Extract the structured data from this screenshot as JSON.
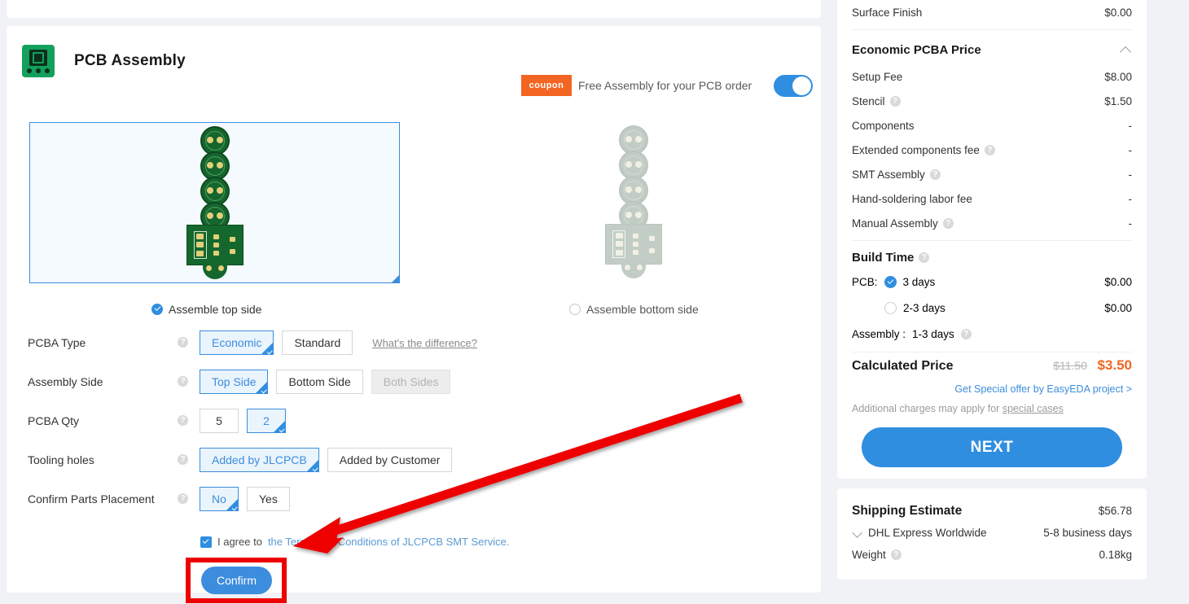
{
  "main": {
    "title": "PCB Assembly",
    "coupon": {
      "badge": "coupon",
      "text": "Free Assembly for your PCB order"
    },
    "sides": {
      "top": "Assemble top side",
      "bottom": "Assemble bottom side"
    },
    "rows": [
      {
        "label": "PCBA Type",
        "options": [
          {
            "label": "Economic",
            "state": "selected"
          },
          {
            "label": "Standard",
            "state": "normal"
          }
        ],
        "link": "What's the difference?"
      },
      {
        "label": "Assembly Side",
        "options": [
          {
            "label": "Top Side",
            "state": "selected"
          },
          {
            "label": "Bottom Side",
            "state": "normal"
          },
          {
            "label": "Both Sides",
            "state": "disabled"
          }
        ]
      },
      {
        "label": "PCBA Qty",
        "options": [
          {
            "label": "5",
            "state": "normal"
          },
          {
            "label": "2",
            "state": "selected"
          }
        ]
      },
      {
        "label": "Tooling holes",
        "options": [
          {
            "label": "Added by JLCPCB",
            "state": "selected"
          },
          {
            "label": "Added by Customer",
            "state": "normal"
          }
        ]
      },
      {
        "label": "Confirm Parts Placement",
        "options": [
          {
            "label": "No",
            "state": "selected"
          },
          {
            "label": "Yes",
            "state": "normal"
          }
        ]
      }
    ],
    "agree": {
      "prefix": "I agree to",
      "link": "the Terms and Conditions of JLCPCB SMT Service."
    },
    "confirm_label": "Confirm"
  },
  "summary": {
    "surface_finish": {
      "label": "Surface Finish",
      "value": "$0.00"
    },
    "price_section_title": "Economic PCBA Price",
    "price_rows": [
      {
        "label": "Setup Fee",
        "value": "$8.00",
        "help": false
      },
      {
        "label": "Stencil",
        "value": "$1.50",
        "help": true
      },
      {
        "label": "Components",
        "value": "-",
        "help": false
      },
      {
        "label": "Extended components fee",
        "value": "-",
        "help": true
      },
      {
        "label": "SMT Assembly",
        "value": "-",
        "help": true
      },
      {
        "label": "Hand-soldering labor fee",
        "value": "-",
        "help": false
      },
      {
        "label": "Manual Assembly",
        "value": "-",
        "help": true
      }
    ],
    "build_time": {
      "title": "Build Time",
      "pcb_label": "PCB:",
      "options": [
        {
          "label": "3 days",
          "value": "$0.00",
          "selected": true
        },
        {
          "label": "2-3 days",
          "value": "$0.00",
          "selected": false
        }
      ],
      "assembly_label": "Assembly :",
      "assembly_value": "1-3 days"
    },
    "calculated": {
      "title": "Calculated Price",
      "old_price": "$11.50",
      "new_price": "$3.50",
      "offer_link": "Get Special offer by EasyEDA project >",
      "note_prefix": "Additional charges may apply for ",
      "note_link": "special cases"
    },
    "next_label": "NEXT"
  },
  "shipping": {
    "title": "Shipping Estimate",
    "price": "$56.78",
    "carrier": "DHL Express Worldwide",
    "eta": "5-8 business days",
    "weight_label": "Weight",
    "weight_value": "0.18kg"
  },
  "colors": {
    "accent_blue": "#2f8ee0",
    "border_blue": "#3c8dde",
    "orange": "#f26522",
    "highlight_red": "#ee0000",
    "page_bg": "#f0f2f5"
  }
}
